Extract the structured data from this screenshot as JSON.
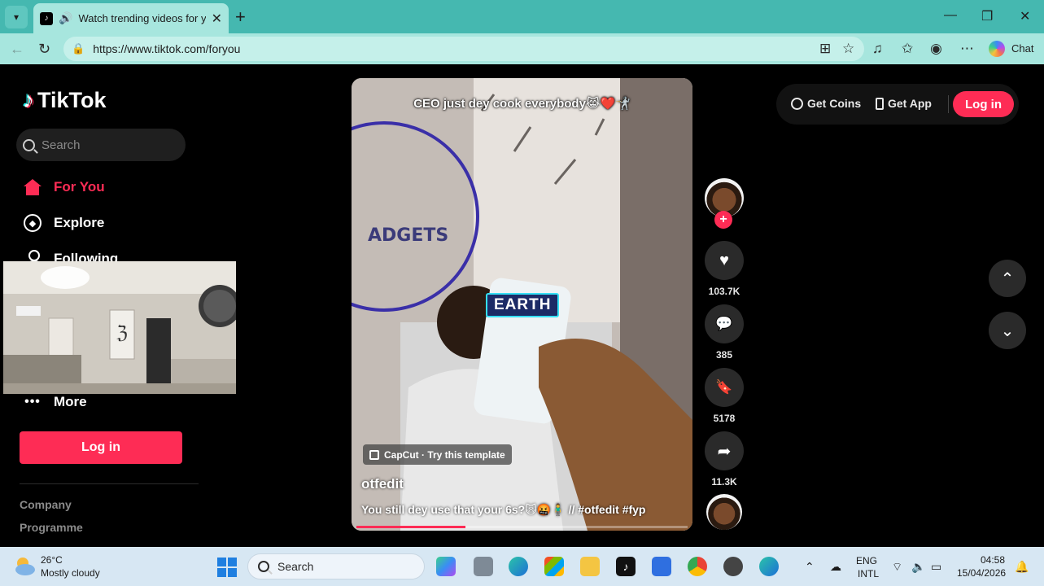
{
  "browser": {
    "tab_title": "Watch trending videos for you",
    "url": "https://www.tiktok.com/foryou",
    "chat_label": "Chat"
  },
  "sidebar": {
    "logo_text": "TikTok",
    "search_placeholder": "Search",
    "items": [
      {
        "label": "For You",
        "icon": "home-icon",
        "active": true
      },
      {
        "label": "Explore",
        "icon": "compass-icon"
      },
      {
        "label": "Following",
        "icon": "person-icon"
      },
      {
        "label": "More",
        "icon": "more-icon"
      }
    ],
    "login_label": "Log in",
    "footer": [
      "Company",
      "Programme"
    ]
  },
  "video": {
    "caption_top": "CEO just dey cook everybody😹❤️🤺",
    "overlay_label": "EARTH",
    "capcut_label": "CapCut · Try this template",
    "author": "otfedit",
    "description": "You still dey use that your 6s?🙀🤬🧍‍♂️ // #otfedit #fyp",
    "progress": 0.33
  },
  "actions": {
    "likes": "103.7K",
    "comments": "385",
    "saves": "5178",
    "shares": "11.3K"
  },
  "header": {
    "get_coins": "Get Coins",
    "get_app": "Get App",
    "login": "Log in"
  },
  "taskbar": {
    "temp": "26°C",
    "weather": "Mostly cloudy",
    "search": "Search",
    "lang_1": "ENG",
    "lang_2": "INTL",
    "time": "04:58",
    "date": "15/04/2026"
  },
  "colors": {
    "accent": "#fe2c55",
    "browser_tab": "#45b8b0"
  }
}
